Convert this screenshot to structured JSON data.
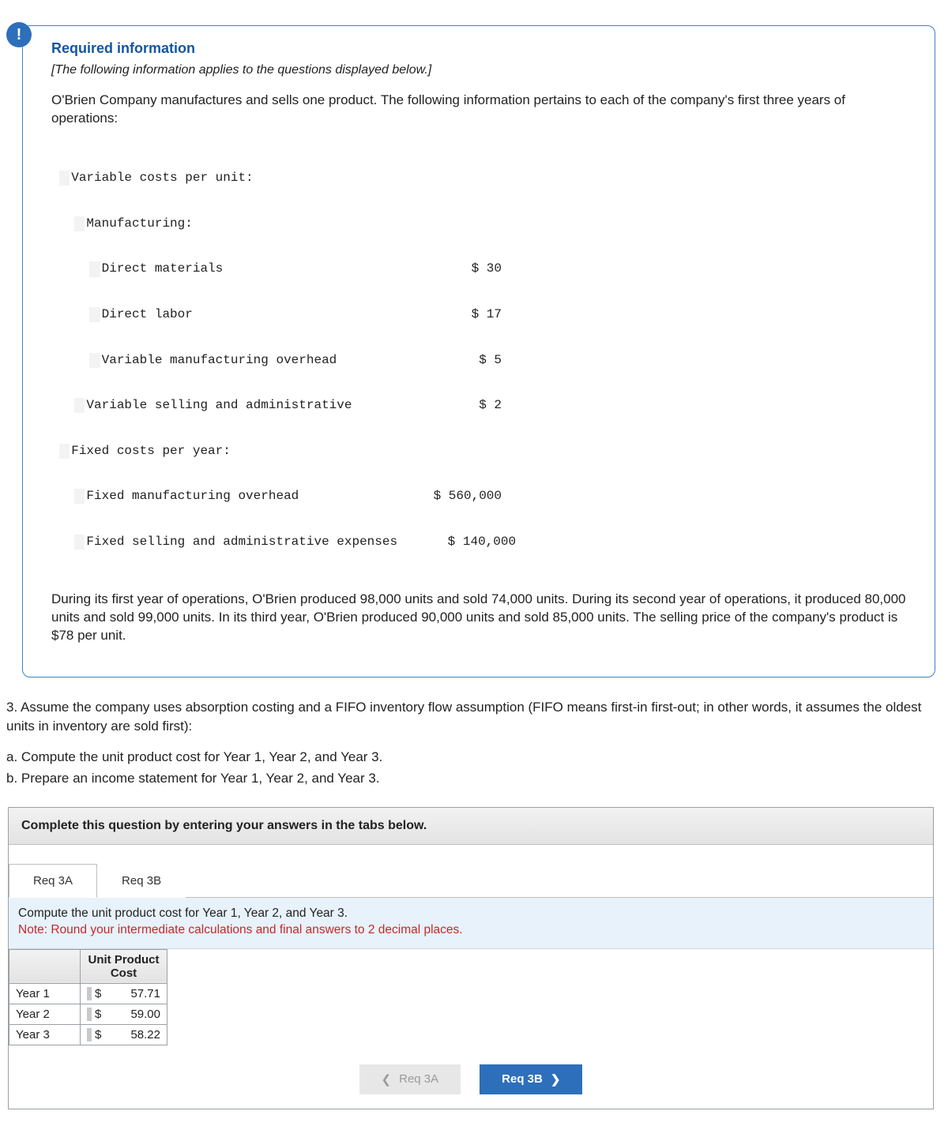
{
  "badge_text": "!",
  "info": {
    "title": "Required information",
    "subtitle": "[The following information applies to the questions displayed below.]",
    "intro": "O'Brien Company manufactures and sells one product. The following information pertains to each of the company's first three years of operations:",
    "cost_block": {
      "l1": "Variable costs per unit:",
      "l2": "Manufacturing:",
      "l3_label": "Direct materials",
      "l3_val": "$ 30",
      "l4_label": "Direct labor",
      "l4_val": "$ 17",
      "l5_label": "Variable manufacturing overhead",
      "l5_val": "$ 5",
      "l6_label": "Variable selling and administrative",
      "l6_val": "$ 2",
      "l7": "Fixed costs per year:",
      "l8_label": "Fixed manufacturing overhead",
      "l8_val": "$ 560,000",
      "l9_label": "Fixed selling and administrative expenses",
      "l9_val": "$ 140,000"
    },
    "body": "During its first year of operations, O'Brien produced 98,000 units and sold 74,000 units. During its second year of operations, it produced 80,000 units and sold 99,000 units. In its third year, O'Brien produced 90,000 units and sold 85,000 units. The selling price of the company's product is $78 per unit."
  },
  "question": {
    "q3": "3. Assume the company uses absorption costing and a FIFO inventory flow assumption (FIFO means first-in first-out; in other words, it assumes the oldest units in inventory are sold first):",
    "qa": "a. Compute the unit product cost for Year 1, Year 2, and Year 3.",
    "qb": "b. Prepare an income statement for Year 1, Year 2, and Year 3."
  },
  "answers": {
    "banner": "Complete this question by entering your answers in the tabs below.",
    "tab_a": "Req 3A",
    "tab_b": "Req 3B",
    "instr_line": "Compute the unit product cost for Year 1, Year 2, and Year 3.",
    "instr_note": "Note: Round your intermediate calculations and final answers to 2 decimal places.",
    "table_header": "Unit Product Cost",
    "row1_label": "Year 1",
    "row1_sym": "$",
    "row1_val": "57.71",
    "row2_label": "Year 2",
    "row2_sym": "$",
    "row2_val": "59.00",
    "row3_label": "Year 3",
    "row3_sym": "$",
    "row3_val": "58.22",
    "prev_btn": "Req 3A",
    "next_btn": "Req 3B"
  }
}
